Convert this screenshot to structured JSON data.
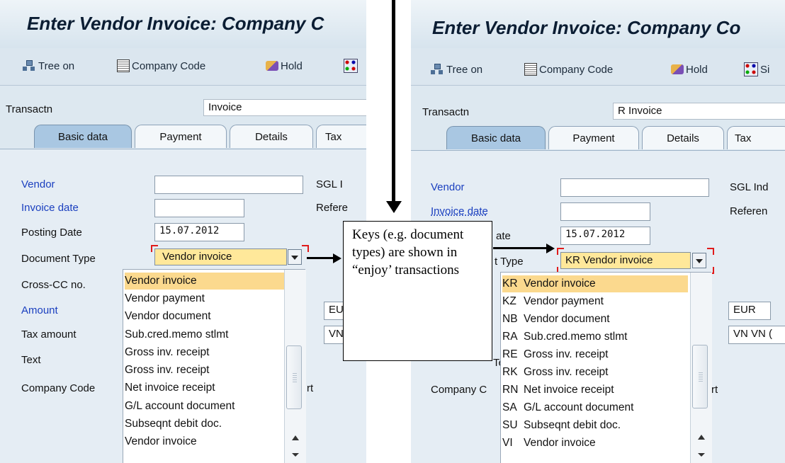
{
  "left": {
    "title": "Enter Vendor Invoice: Company C",
    "toolbar": {
      "tree_label": "Tree on",
      "company_code_label": "Company Code",
      "hold_label": "Hold",
      "simulate_label": ""
    },
    "transactn_label": "Transactn",
    "transactn_value": "Invoice",
    "tabs": [
      "Basic data",
      "Payment",
      "Details",
      "Tax"
    ],
    "fields": {
      "vendor": "Vendor",
      "invoice_date": "Invoice date",
      "posting_date": "Posting Date",
      "posting_date_value": "15.07.2012",
      "document_type": "Document Type",
      "document_type_value": "Vendor invoice",
      "cross_cc": "Cross-CC no.",
      "amount": "Amount",
      "tax_amount": "Tax amount",
      "text": "Text",
      "company_code": "Company Code",
      "sgl_ind": "SGL I",
      "reference": "Refere",
      "currency_value": "EU",
      "tax_code_value": "VN",
      "company_code_suffix": "rt"
    },
    "dropdown_items": [
      "Vendor invoice",
      "Vendor payment",
      "Vendor document",
      "Sub.cred.memo stlmt",
      "Gross inv. receipt",
      "Gross inv. receipt",
      "Net invoice receipt",
      "G/L account document",
      "Subseqnt debit doc.",
      "Vendor invoice"
    ]
  },
  "right": {
    "title": "Enter Vendor Invoice: Company Co",
    "toolbar": {
      "tree_label": "Tree on",
      "company_code_label": "Company Code",
      "hold_label": "Hold",
      "simulate_label": "Si"
    },
    "transactn_label": "Transactn",
    "transactn_value": "R Invoice",
    "tabs": [
      "Basic data",
      "Payment",
      "Details",
      "Tax"
    ],
    "fields": {
      "vendor": "Vendor",
      "invoice_date": "Invoice date",
      "posting_date_partial": "ate",
      "posting_date_value": "15.07.2012",
      "document_type_partial": "t Type",
      "document_type_value": "KR Vendor invoice",
      "company_code_partial": "Company C",
      "text_partial": "Text",
      "sgl_ind": "SGL Ind",
      "reference": "Referen",
      "currency_value": "EUR",
      "tax_code_value": "VN VN (",
      "company_code_suffix": "rt"
    },
    "dropdown_items": [
      {
        "key": "KR",
        "label": "Vendor invoice"
      },
      {
        "key": "KZ",
        "label": "Vendor payment"
      },
      {
        "key": "NB",
        "label": "Vendor document"
      },
      {
        "key": "RA",
        "label": "Sub.cred.memo stlmt"
      },
      {
        "key": "RE",
        "label": "Gross inv. receipt"
      },
      {
        "key": "RK",
        "label": "Gross inv. receipt"
      },
      {
        "key": "RN",
        "label": "Net invoice receipt"
      },
      {
        "key": "SA",
        "label": "G/L account document"
      },
      {
        "key": "SU",
        "label": "Subseqnt debit doc."
      },
      {
        "key": "VI",
        "label": "Vendor invoice"
      }
    ]
  },
  "callout": {
    "text": "Keys (e.g. document types) are shown in “enjoy’ transactions"
  },
  "colors": {
    "field_label_link": "#1a3fbf",
    "highlight": "#fbd98e",
    "selection_marker": "#e01b1b",
    "active_tab": "#a9c7e2"
  },
  "icons": [
    "tree-icon",
    "company-code-icon",
    "hold-icon",
    "simulate-icon",
    "dropdown-arrow-icon"
  ]
}
